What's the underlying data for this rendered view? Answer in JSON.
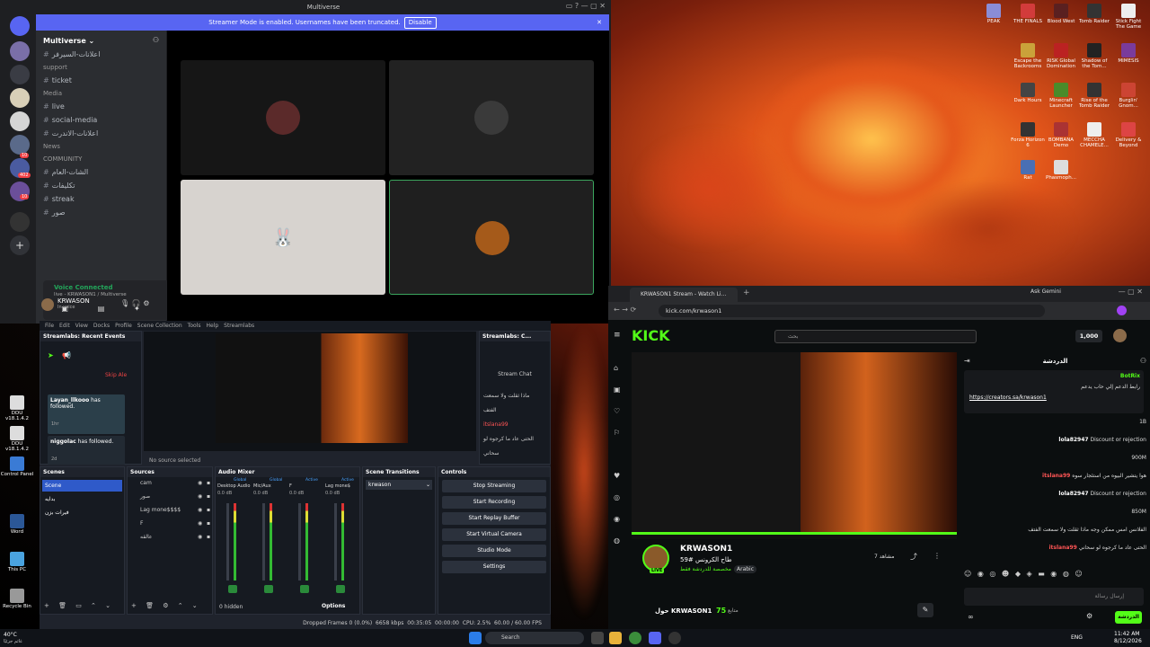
{
  "discord": {
    "window_title": "Multiverse",
    "banner_text": "Streamer Mode is enabled. Usernames have been truncated.",
    "banner_button": "Disable",
    "server_name": "Multiverse",
    "server_badges": [
      "10",
      "402",
      "10"
    ],
    "channels": [
      {
        "type": "channel",
        "label": "اعلانات-السيرفر"
      },
      {
        "type": "header",
        "label": "support"
      },
      {
        "type": "channel",
        "label": "ticket"
      },
      {
        "type": "header",
        "label": "Media"
      },
      {
        "type": "channel",
        "label": "live"
      },
      {
        "type": "channel",
        "label": "social-media"
      },
      {
        "type": "channel",
        "label": "اعلانات-الاندرت"
      },
      {
        "type": "header",
        "label": "News"
      },
      {
        "type": "header",
        "label": "COMMUNITY"
      },
      {
        "type": "channel",
        "label": "الشات-العام"
      },
      {
        "type": "channel",
        "label": "تكليفات"
      },
      {
        "type": "channel",
        "label": "streak"
      },
      {
        "type": "channel",
        "label": "صور"
      }
    ],
    "voice_status": "Voice Connected",
    "voice_detail": "live - KRWASON1 / Multiverse",
    "username": "KRWASON",
    "user_status": "In voice"
  },
  "desktop_icons": [
    {
      "label": "PEAK",
      "color": "#8a8dd6"
    },
    {
      "label": "THE FINALS",
      "color": "#d23b3b"
    },
    {
      "label": "Blood West",
      "color": "#5a2020"
    },
    {
      "label": "Tomb Raider",
      "color": "#333"
    },
    {
      "label": "Stick Fight The Game",
      "color": "#eee"
    },
    {
      "label": "Escape the Backrooms",
      "color": "#caa23a"
    },
    {
      "label": "RISK Global Domination",
      "color": "#b22"
    },
    {
      "label": "Shadow of the Tom...",
      "color": "#222"
    },
    {
      "label": "MIMESIS",
      "color": "#7a3b9b"
    },
    {
      "label": "Dark Hours",
      "color": "#444"
    },
    {
      "label": "Minecraft Launcher",
      "color": "#4a8b2a"
    },
    {
      "label": "Rise of the Tomb Raider",
      "color": "#333"
    },
    {
      "label": "Burglin' Gnom...",
      "color": "#c43"
    },
    {
      "label": "Forza Horizon 6",
      "color": "#333"
    },
    {
      "label": "BOMBANA Demo",
      "color": "#a33"
    },
    {
      "label": "MECCHA CHAMELE...",
      "color": "#eee"
    },
    {
      "label": "Delivery & Beyond",
      "color": "#d44"
    },
    {
      "label": "Rat",
      "color": "#4a6fb4"
    },
    {
      "label": "Phasmoph...",
      "color": "#ddd"
    }
  ],
  "left_desktop_icons": [
    {
      "label": "DDU v18.1.4.2",
      "color": "#ddd"
    },
    {
      "label": "DDU v18.1.4.2",
      "color": "#ddd"
    },
    {
      "label": "Control Panel",
      "color": "#3a7bd5"
    },
    {
      "label": "Word",
      "color": "#2b5797"
    },
    {
      "label": "This PC",
      "color": "#4aa3df"
    },
    {
      "label": "Recycle Bin",
      "color": "#999"
    }
  ],
  "obs": {
    "menu": [
      "File",
      "Edit",
      "View",
      "Docks",
      "Profile",
      "Scene Collection",
      "Tools",
      "Help",
      "Streamlabs"
    ],
    "recent_events_title": "Streamlabs: Recent Events",
    "skip_alert": "Skip Ale",
    "events": [
      {
        "user": "Layan_llkooo",
        "action": "has followed.",
        "time": "1hr"
      },
      {
        "user": "niggolac",
        "action": "has followed.",
        "time": "2d"
      }
    ],
    "chat_title": "Streamlabs: C...",
    "stream_chat": "Stream Chat",
    "chat_lines": [
      "ماذا ثقلت ولا سمعت",
      "الفتف",
      "itslana99",
      "الحتى عاد ما كرجوه لو",
      "سحاني"
    ],
    "no_source": "No source selected",
    "scenes_title": "Scenes",
    "scenes": [
      "Scene",
      "بدايه",
      "فيرات بزن"
    ],
    "sources_title": "Sources",
    "sources": [
      "cam",
      "صور",
      "Lag mone$$$$",
      "F",
      "عالقه"
    ],
    "mixer_title": "Audio Mixer",
    "mixer_channels": [
      {
        "name": "Desktop Audio",
        "db": "0.0 dB",
        "tag": "Global"
      },
      {
        "name": "Mic/Aux",
        "db": "0.0 dB",
        "tag": "Global"
      },
      {
        "name": "F",
        "db": "0.0 dB",
        "tag": "Active"
      },
      {
        "name": "Lag mone$",
        "db": "0.0 dB",
        "tag": "Active"
      }
    ],
    "hidden": "0 hidden",
    "options": "Options",
    "transitions_title": "Scene Transitions",
    "transition": "krwason",
    "controls_title": "Controls",
    "controls": [
      "Stop Streaming",
      "Start Recording",
      "Start Replay Buffer",
      "Start Virtual Camera",
      "Studio Mode",
      "Settings"
    ],
    "status": {
      "dropped": "Dropped Frames 0 (0.0%)",
      "kbps": "6658 kbps",
      "time": "00:35:05",
      "rec": "00:00:00",
      "cpu": "CPU: 2.5%",
      "fps": "60.00 / 60.00 FPS"
    }
  },
  "browser": {
    "tab_title": "KRWASON1 Stream - Watch Li...",
    "gemini": "Ask Gemini",
    "url": "kick.com/krwason1",
    "logo": "KICK",
    "search_placeholder": "بحث",
    "balance": "1,000",
    "streamer": "KRWASON1",
    "stream_title": "طاح الكرونس #59",
    "subtitle": "مخصصة للدردشة فقط",
    "language": "Arabic",
    "viewers": "7 مشاهد",
    "live": "LIVE",
    "about": "حول KRWASON1",
    "followers_count": "75",
    "followers_label": "متابع",
    "chat_header": "الدردشة",
    "pinned_user": "BotRix",
    "pinned_text": "رابط الدعم إلي حاب يدعم",
    "pinned_link": "https://creators.sa/krwason1",
    "chat_messages": [
      {
        "user": "",
        "text": "1B"
      },
      {
        "user": "lola82947",
        "text": "Discount or rejection"
      },
      {
        "user": "",
        "text": "900M"
      },
      {
        "user": "itslana99",
        "text": "هوا يتشير البيوه من استئجار سوه"
      },
      {
        "user": "lola82947",
        "text": "Discount or rejection"
      },
      {
        "user": "",
        "text": "850M"
      },
      {
        "user": "",
        "text": "الفلانس امس ممكن وجه ماذا ثقلت ولا سمعت الفتف"
      },
      {
        "user": "itslana99",
        "text": "الحتى عاد ما كرجوه لو سحاني"
      }
    ],
    "chat_placeholder": "إرسال رسالة",
    "chat_button": "الدردشة"
  },
  "taskbar": {
    "temp": "40°C",
    "weather": "غائم جزئيًا",
    "search": "Search",
    "lang": "ENG",
    "time": "11:42 AM",
    "date": "8/12/2026"
  }
}
